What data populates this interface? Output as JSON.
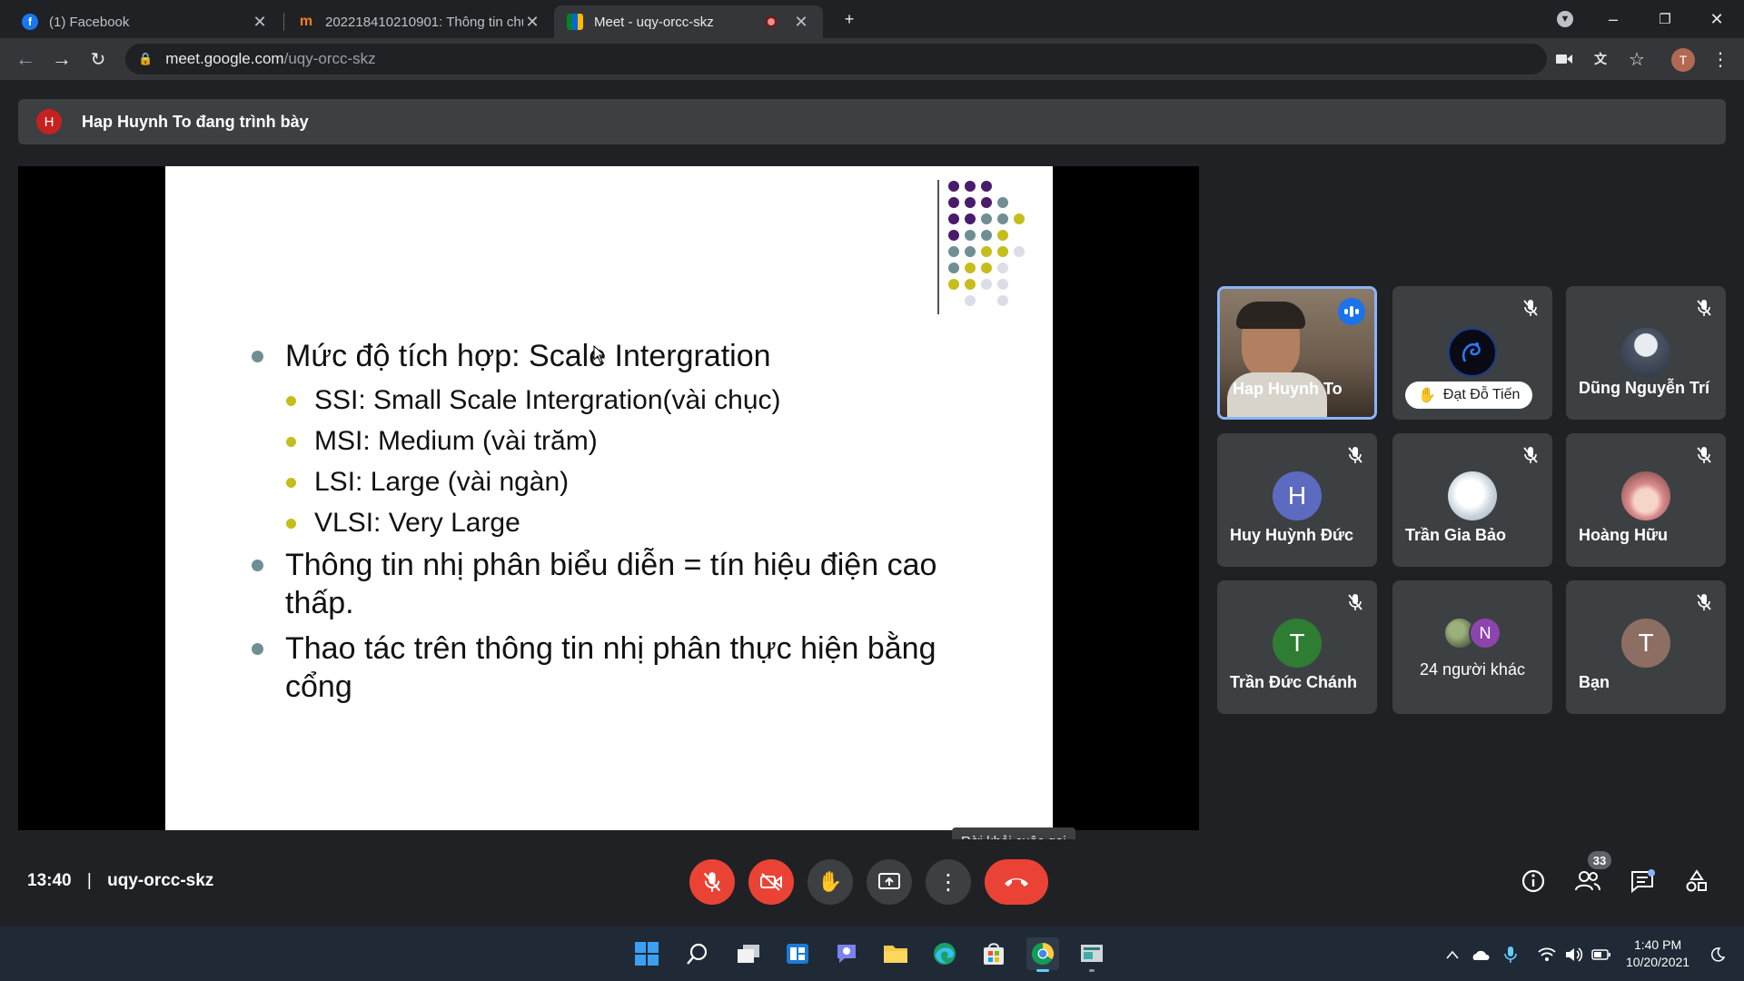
{
  "browser": {
    "tabs": [
      {
        "title": "(1) Facebook",
        "icon": "facebook-icon",
        "active": false
      },
      {
        "title": "202218410210901: Thông tin chu",
        "icon": "moodle-icon",
        "active": false
      },
      {
        "title": "Meet - uqy-orcc-skz",
        "icon": "meet-icon",
        "active": true
      }
    ],
    "url_host": "meet.google.com",
    "url_path": "/uqy-orcc-skz",
    "profile_initial": "T"
  },
  "banner": {
    "avatar_initial": "H",
    "text": "Hap Huynh To đang trình bày"
  },
  "slide": {
    "bullets": [
      {
        "level": 1,
        "text": "Mức độ tích hợp: Scale Intergration"
      },
      {
        "level": 2,
        "text": "SSI: Small Scale Intergration(vài chục)"
      },
      {
        "level": 2,
        "text": "MSI: Medium (vài trăm)"
      },
      {
        "level": 2,
        "text": "LSI: Large (vài ngàn)"
      },
      {
        "level": 2,
        "text": "VLSI: Very Large"
      },
      {
        "level": 1,
        "line1": "Thông tin nhị phân biểu diễn = tín hiệu điện cao",
        "line2": "thấp."
      },
      {
        "level": 1,
        "line1": "Thao tác trên thông tin nhị phân thực hiện bằng",
        "line2": "cổng"
      }
    ],
    "colors": {
      "purple": "#4a1b6a",
      "teal": "#6f8f93",
      "yellow": "#c6bd1c",
      "light": "#dcdde6"
    }
  },
  "participants": [
    {
      "name": "Hap Huynh To",
      "type": "video",
      "speaking": true
    },
    {
      "name": "Đạt Đỗ Tiến",
      "type": "pill",
      "avatar_icon": "dragon-avatar-icon"
    },
    {
      "name": "Dũng Nguyễn Trí",
      "type": "photo",
      "avatar_icon": "person-photo-icon"
    },
    {
      "name": "Huy Huỳnh Đức",
      "type": "initial",
      "initial": "H",
      "color": "#5c6bc0"
    },
    {
      "name": "Trần Gia Bảo",
      "type": "photo",
      "avatar_icon": "sketch-photo-icon"
    },
    {
      "name": "Hoàng Hữu",
      "type": "photo",
      "avatar_icon": "anime-photo-icon"
    },
    {
      "name": "Trần Đức Chánh",
      "type": "initial",
      "initial": "T",
      "color": "#2e7d32"
    },
    {
      "name": "24 người khác",
      "type": "others",
      "initial": "N",
      "color": "#8e44ad"
    },
    {
      "name": "Bạn",
      "type": "initial",
      "initial": "T",
      "color": "#8d6e63"
    }
  ],
  "meeting": {
    "time": "13:40",
    "separator": "|",
    "code": "uqy-orcc-skz",
    "leave_tooltip": "Rời khỏi cuộc gọi",
    "participant_count": "33"
  },
  "taskbar": {
    "time": "1:40 PM",
    "date": "10/20/2021"
  }
}
